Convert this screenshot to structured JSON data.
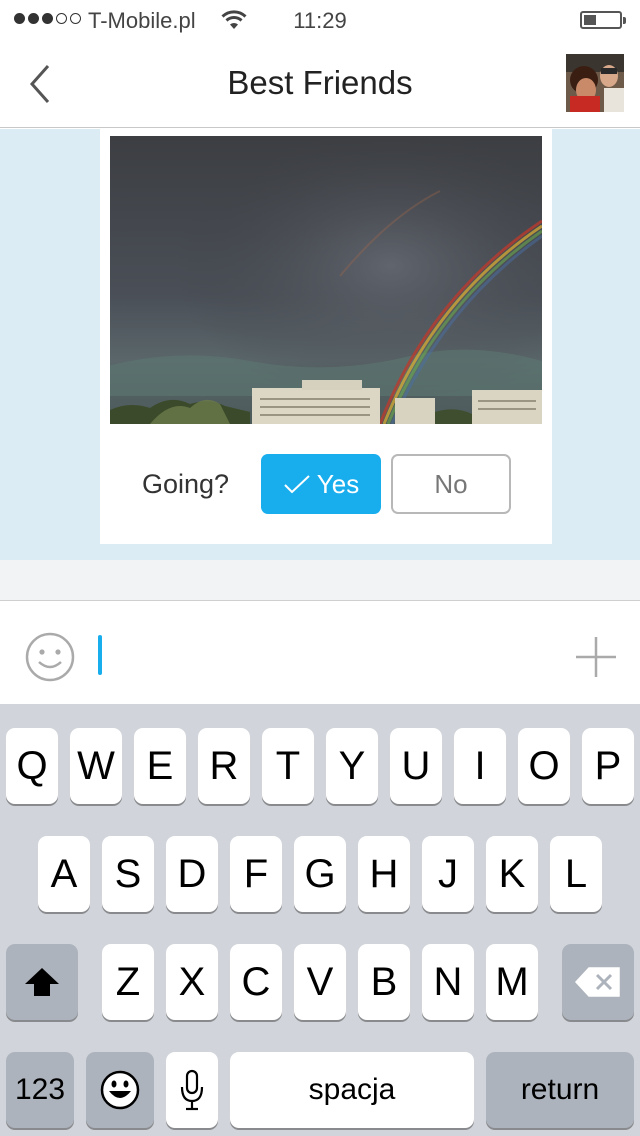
{
  "status_bar": {
    "carrier": "T-Mobile.pl",
    "time": "11:29",
    "signal_bars_filled": 3,
    "signal_bars_total": 5,
    "battery_level": 0.35
  },
  "header": {
    "title": "Best Friends",
    "back_icon": "chevron-left-icon",
    "avatar": "group-avatar"
  },
  "message": {
    "photo": "rainbow-photo",
    "prompt": "Going?",
    "yes_label": "Yes",
    "no_label": "No",
    "selected": "Yes",
    "accent_color": "#18aeee"
  },
  "composer": {
    "emoji_icon": "smiley-icon",
    "add_icon": "plus-icon",
    "text": ""
  },
  "keyboard": {
    "row1": [
      "Q",
      "W",
      "E",
      "R",
      "T",
      "Y",
      "U",
      "I",
      "O",
      "P"
    ],
    "row2": [
      "A",
      "S",
      "D",
      "F",
      "G",
      "H",
      "J",
      "K",
      "L"
    ],
    "row3": [
      "Z",
      "X",
      "C",
      "V",
      "B",
      "N",
      "M"
    ],
    "numbers_label": "123",
    "space_label": "spacja",
    "return_label": "return"
  }
}
